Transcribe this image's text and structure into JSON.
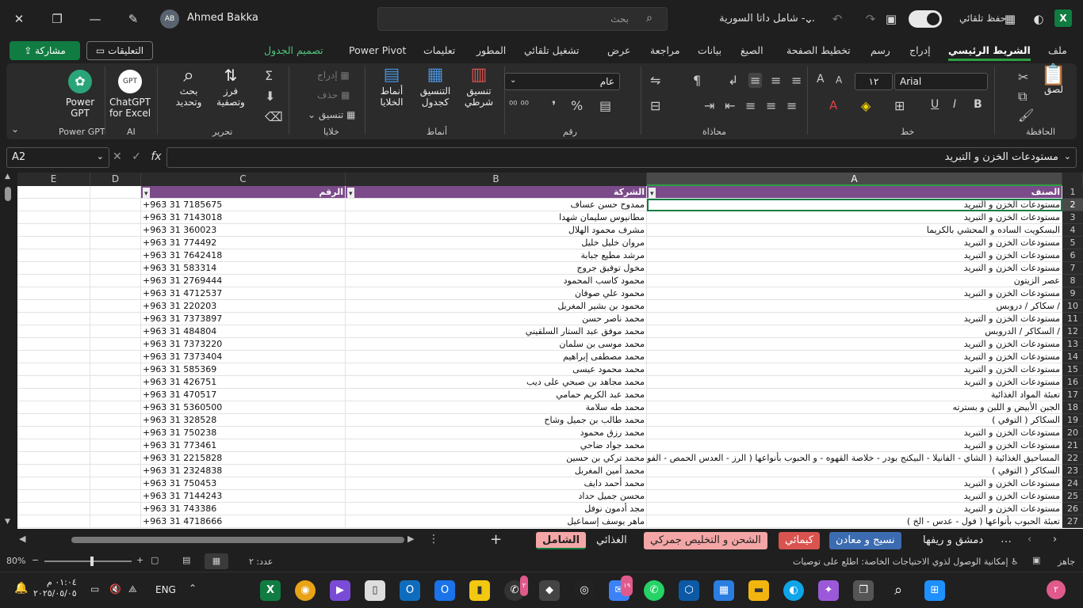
{
  "titlebar": {
    "user_initials": "AB",
    "user_name": "Ahmed Bakka",
    "search_placeholder": "بحث",
    "doc_title": "شامل داتا السورية -...",
    "autosave_label": "حفظ تلقائي"
  },
  "tabs": {
    "share": "مشاركة",
    "comments": "التعليقات",
    "items": [
      "ملف",
      "الشريط الرئيسي",
      "إدراج",
      "رسم",
      "تخطيط الصفحة",
      "الصيغ",
      "بيانات",
      "مراجعة",
      "عرض",
      "تشغيل تلقائي",
      "المطور",
      "تعليمات",
      "Power Pivot",
      "تصميم الجدول"
    ]
  },
  "ribbon": {
    "clipboard": {
      "label": "الحافظة",
      "paste": "لصق"
    },
    "font": {
      "label": "خط",
      "name": "Arial",
      "size": "١٢"
    },
    "alignment": {
      "label": "محاذاة"
    },
    "number": {
      "label": "رقم",
      "format": "عام"
    },
    "styles": {
      "label": "أنماط",
      "conditional": "تنسيق شرطي",
      "as_table": "التنسيق كجدول",
      "cell_styles": "أنماط الخلايا"
    },
    "cells": {
      "label": "خلايا",
      "insert": "إدراج",
      "delete": "حذف",
      "format": "تنسيق"
    },
    "editing": {
      "label": "تحرير",
      "sort": "فرز وتصفية",
      "find": "بحث وتحديد"
    },
    "ai": {
      "label": "AI",
      "chatgpt": "ChatGPT for Excel",
      "chatgpt_icon": "GPT"
    },
    "powergpt": {
      "label": "Power GPT",
      "btn": "Power GPT"
    }
  },
  "formula_bar": {
    "name_box": "A2",
    "formula": "مستودعات الخزن و التبريد",
    "fx": "fx"
  },
  "columns": [
    "A",
    "B",
    "C",
    "D",
    "E"
  ],
  "table": {
    "headers": {
      "A": "الصنف",
      "B": "الشركة",
      "C": "الرقم"
    },
    "rows": [
      {
        "n": "2",
        "a": "مستودعات الخزن و التبريد",
        "b": "ممدوح حسن عساف",
        "c": "+963 31 7185675"
      },
      {
        "n": "3",
        "a": "مستودعات الخزن و التبريد",
        "b": "مطانيوس سليمان شهدا",
        "c": "+963 31 7143018"
      },
      {
        "n": "4",
        "a": "البسكويت الساده و المحشي بالكريما",
        "b": "مشرف محمود الهلال",
        "c": "+963 31 360023"
      },
      {
        "n": "5",
        "a": "مستودعات الخزن و التبريد",
        "b": "مروان خليل خليل",
        "c": "+963 31 774492"
      },
      {
        "n": "6",
        "a": "مستودعات الخزن و التبريد",
        "b": "مرشد مطيع جبابة",
        "c": "+963 31 7642418"
      },
      {
        "n": "7",
        "a": "مستودعات الخزن و التبريد",
        "b": "مخول توفيق جروج",
        "c": "+963 31 583314"
      },
      {
        "n": "8",
        "a": "عصر الزيتون",
        "b": "محمود كاسب المحمود",
        "c": "+963 31 2769444"
      },
      {
        "n": "9",
        "a": "مستودعات الخزن و التبريد",
        "b": "محمود علي صوفان",
        "c": "+963 31 4712537"
      },
      {
        "n": "10",
        "a": "سكاكر / دروبس /",
        "b": "محمود بن بشير المغربل",
        "c": "+963 31 220203"
      },
      {
        "n": "11",
        "a": "مستودعات الخزن و التبريد",
        "b": "محمد ناصر حسن",
        "c": "+963 31 7373897"
      },
      {
        "n": "12",
        "a": "السكاكر / الدروبس /",
        "b": "محمد موفق عبد الستار السلقيني",
        "c": "+963 31 484804"
      },
      {
        "n": "13",
        "a": "مستودعات الخزن و التبريد",
        "b": "محمد موسى بن سلمان",
        "c": "+963 31 7373220"
      },
      {
        "n": "14",
        "a": "مستودعات الخزن و التبريد",
        "b": "محمد مصطفى إبراهيم",
        "c": "+963 31 7373404"
      },
      {
        "n": "15",
        "a": "مستودعات الخزن و التبريد",
        "b": "محمد محمود عيسى",
        "c": "+963 31 585369"
      },
      {
        "n": "16",
        "a": "مستودعات الخزن و التبريد",
        "b": "محمد مجاهد بن صبحي على ديب",
        "c": "+963 31 426751"
      },
      {
        "n": "17",
        "a": "تعبئة المواد الغذائية",
        "b": "محمد عبد الكريم حمامي",
        "c": "+963 31 470517"
      },
      {
        "n": "18",
        "a": "الجبن الأبيض و اللبن و بسترته",
        "b": "محمد طه سلامة",
        "c": "+963 31 5360500"
      },
      {
        "n": "19",
        "a": "السكاكر ( التوفي )",
        "b": "محمد طالب بن جميل وشاح",
        "c": "+963 31 328528"
      },
      {
        "n": "20",
        "a": "مستودعات الخزن و التبريد",
        "b": "محمد رزق محمود",
        "c": "+963 31 750238"
      },
      {
        "n": "21",
        "a": "مستودعات الخزن و التبريد",
        "b": "محمد جواد ضاحي",
        "c": "+963 31 773461"
      },
      {
        "n": "22",
        "a": "تعبئة المساحيق الغذائية ( الشاي - الفانيلا - البيكنج بودر - خلاصة القهوه - و الحبوب بأنواعها ( الرز - العدس الحمص - الفو",
        "b": "محمد تركي بن حسين",
        "c": "+963 31 2215828"
      },
      {
        "n": "23",
        "a": "السكاكر ( التوفي )",
        "b": "محمد أمين المغربل",
        "c": "+963 31 2324838"
      },
      {
        "n": "24",
        "a": "مستودعات الخزن و التبريد",
        "b": "محمد أحمد دايف",
        "c": "+963 31 750453"
      },
      {
        "n": "25",
        "a": "مستودعات الخزن و التبريد",
        "b": "محسن جميل حداد",
        "c": "+963 31 7144243"
      },
      {
        "n": "26",
        "a": "مستودعات الخزن و التبريد",
        "b": "مجد أدمون نوفل",
        "c": "+963 31 743386"
      },
      {
        "n": "27",
        "a": "تعبئة الحبوب بأنواعها ( فول - عدس - الخ )",
        "b": "ماهر يوسف إسماعيل",
        "c": "+963 31 4718666"
      }
    ]
  },
  "sheets": [
    {
      "label": "دمشق و ريفها",
      "color": "#1f1f1f",
      "text": "#eeeeee"
    },
    {
      "label": "نسيج و معادن",
      "color": "#3b6bb0",
      "text": "#ffffff"
    },
    {
      "label": "كيمائي",
      "color": "#d9534f",
      "text": "#ffffff"
    },
    {
      "label": "الشحن و التخليص جمركي",
      "color": "#f4a6a6",
      "text": "#222222"
    },
    {
      "label": "الغذائي",
      "color": "#1f1f1f",
      "text": "#eeeeee"
    },
    {
      "label": "الشامل",
      "color": "#f4a6a6",
      "text": "#222222"
    }
  ],
  "status": {
    "ready": "جاهز",
    "accessibility": "إمكانية الوصول لذوي الاحتياجات الخاصة: اطلع على توصيات",
    "count": "عدد: ٢",
    "zoom": "80%"
  },
  "taskbar": {
    "time": "٠١:٠٤ م",
    "date": "٢٠٢٥/٠٥/٠٥",
    "lang": "ENG",
    "notif_count": "٢",
    "mail_badge": "١٩",
    "whatsapp_badge": "٣"
  },
  "colors": {
    "accent": "#107c41",
    "table_header": "#7b4b8a",
    "active_tab_underline": "#2ea043"
  }
}
